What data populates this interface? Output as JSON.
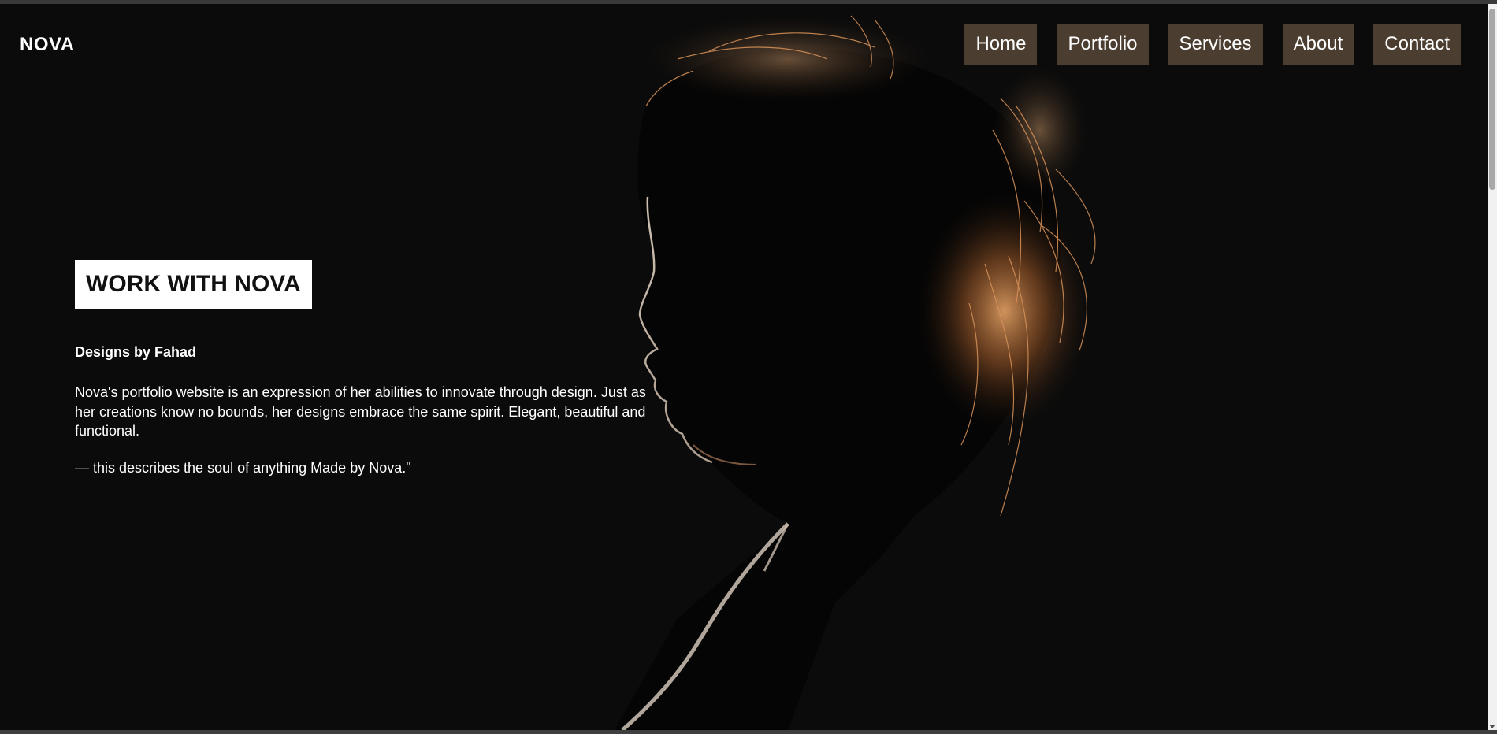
{
  "brand": {
    "logo": "NOVA"
  },
  "nav": {
    "items": [
      {
        "label": "Home"
      },
      {
        "label": "Portfolio"
      },
      {
        "label": "Services"
      },
      {
        "label": "About"
      },
      {
        "label": "Contact"
      }
    ]
  },
  "hero": {
    "headline": "WORK WITH NOVA",
    "subtitle": "Designs by Fahad",
    "description": "Nova's portfolio website is an expression of her abilities to innovate through design. Just as her creations know no bounds, her designs embrace the same spirit. Elegant, beautiful and functional.",
    "quote": "— this describes the soul of anything Made by Nova.\"",
    "image": "silhouette-portrait-backlit"
  },
  "colors": {
    "background": "#0b0b0b",
    "nav_button": "#4b3e30",
    "text": "#ffffff",
    "headline_box": "#ffffff",
    "hair_highlight": "#c8834a"
  }
}
